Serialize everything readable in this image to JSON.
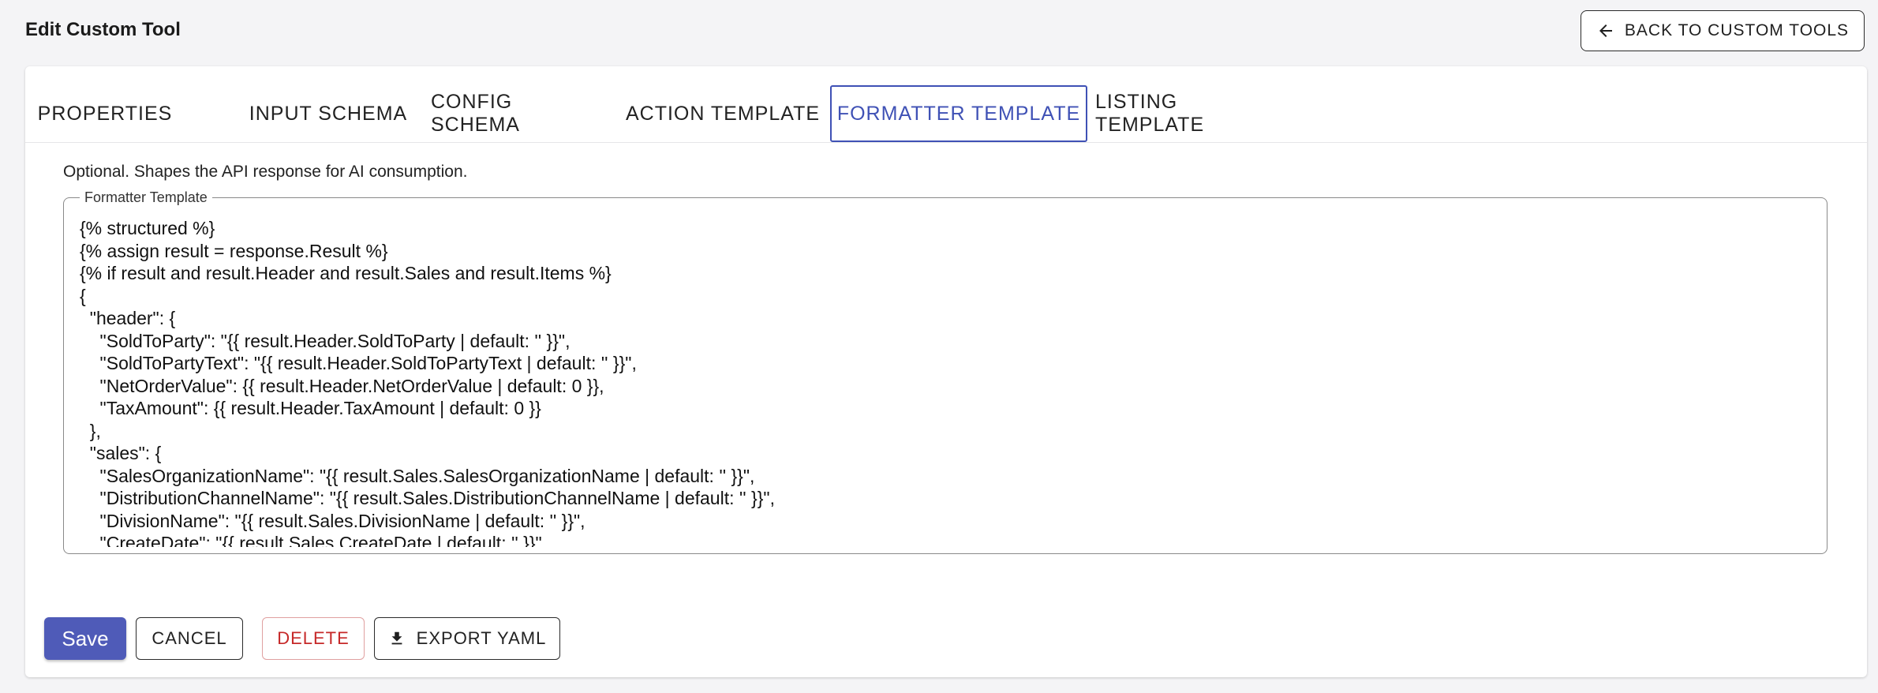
{
  "header": {
    "title": "Edit Custom Tool",
    "back_button_label": "BACK TO CUSTOM TOOLS",
    "back_icon": "arrow-left-icon"
  },
  "tabs": [
    {
      "label": "PROPERTIES",
      "active": false
    },
    {
      "label": "INPUT SCHEMA",
      "active": false
    },
    {
      "label": "CONFIG SCHEMA",
      "active": false
    },
    {
      "label": "ACTION TEMPLATE",
      "active": false
    },
    {
      "label": "FORMATTER TEMPLATE",
      "active": true
    },
    {
      "label": "LISTING TEMPLATE",
      "active": false
    }
  ],
  "formatter": {
    "description": "Optional. Shapes the API response for AI consumption.",
    "field_label": "Formatter Template",
    "value": "{% structured %}\n{% assign result = response.Result %}\n{% if result and result.Header and result.Sales and result.Items %}\n{\n  \"header\": {\n    \"SoldToParty\": \"{{ result.Header.SoldToParty | default: '' }}\",\n    \"SoldToPartyText\": \"{{ result.Header.SoldToPartyText | default: '' }}\",\n    \"NetOrderValue\": {{ result.Header.NetOrderValue | default: 0 }},\n    \"TaxAmount\": {{ result.Header.TaxAmount | default: 0 }}\n  },\n  \"sales\": {\n    \"SalesOrganizationName\": \"{{ result.Sales.SalesOrganizationName | default: '' }}\",\n    \"DistributionChannelName\": \"{{ result.Sales.DistributionChannelName | default: '' }}\",\n    \"DivisionName\": \"{{ result.Sales.DivisionName | default: '' }}\",\n    \"CreateDate\": \"{{ result.Sales.CreateDate | default: '' }}\""
  },
  "actions": {
    "save_label": "Save",
    "cancel_label": "CANCEL",
    "delete_label": "DELETE",
    "export_label": "EXPORT YAML",
    "export_icon": "download-icon"
  },
  "colors": {
    "primary": "#3f51b5",
    "save_button": "#4f5bb8",
    "danger": "#c62828",
    "background": "#f4f4f6"
  }
}
